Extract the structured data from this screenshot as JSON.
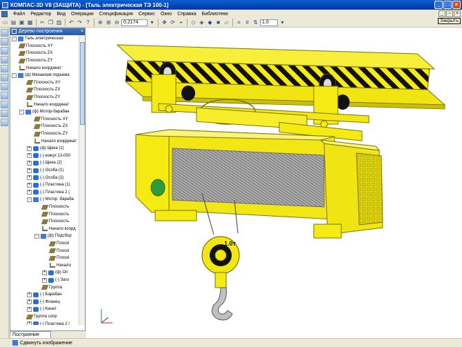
{
  "window": {
    "title": "КОМПАС-3D V8 (ЗАЩИТА) - [Таль электрическая   ТЭ 100-1]",
    "tooltip": "Закрыть"
  },
  "menu": {
    "items": [
      "Файл",
      "Редактор",
      "Вид",
      "Операции",
      "Спецификация",
      "Сервис",
      "Окно",
      "Справка",
      "Библиотеки"
    ]
  },
  "toolbar": {
    "zoom_value": "0.2174",
    "step_value": "1.0"
  },
  "tree": {
    "title": "Дерево построения",
    "tab_label": "Построение",
    "rows": [
      {
        "text": "Таль электрическая",
        "indent": 0,
        "icon": "asm",
        "exp": "-"
      },
      {
        "text": "Плоскость XY",
        "indent": 1,
        "icon": "plane",
        "exp": ""
      },
      {
        "text": "Плоскость ZX",
        "indent": 1,
        "icon": "plane",
        "exp": ""
      },
      {
        "text": "Плоскость ZY",
        "indent": 1,
        "icon": "plane",
        "exp": ""
      },
      {
        "text": "Начало координат",
        "indent": 1,
        "icon": "axis",
        "exp": ""
      },
      {
        "text": "(ф) Механизм подъема",
        "indent": 0,
        "icon": "asm",
        "exp": "-"
      },
      {
        "text": "Плоскость XY",
        "indent": 2,
        "icon": "plane",
        "exp": ""
      },
      {
        "text": "Плоскость ZX",
        "indent": 2,
        "icon": "plane",
        "exp": ""
      },
      {
        "text": "Плоскость ZY",
        "indent": 2,
        "icon": "plane",
        "exp": ""
      },
      {
        "text": "Начало координат",
        "indent": 2,
        "icon": "axis",
        "exp": ""
      },
      {
        "text": "(ф) Мотор-барабан",
        "indent": 1,
        "icon": "asm",
        "exp": "-"
      },
      {
        "text": "Плоскость XY",
        "indent": 3,
        "icon": "plane",
        "exp": ""
      },
      {
        "text": "Плоскость ZX",
        "indent": 3,
        "icon": "plane",
        "exp": ""
      },
      {
        "text": "Плоскость ZY",
        "indent": 3,
        "icon": "plane",
        "exp": ""
      },
      {
        "text": "Начало координат",
        "indent": 3,
        "icon": "axis",
        "exp": ""
      },
      {
        "text": "(ф) Щека (1)",
        "indent": 2,
        "icon": "part",
        "exp": "+"
      },
      {
        "text": "(-) кожух 13-050",
        "indent": 2,
        "icon": "part",
        "exp": "+"
      },
      {
        "text": "(-) Щека (2)",
        "indent": 2,
        "icon": "part",
        "exp": "+"
      },
      {
        "text": "(-) Ocoба (1)",
        "indent": 2,
        "icon": "part",
        "exp": "+"
      },
      {
        "text": "(-) Ocoба (2)",
        "indent": 2,
        "icon": "part",
        "exp": "+"
      },
      {
        "text": "(-) Пластина (1)",
        "indent": 2,
        "icon": "part",
        "exp": "+"
      },
      {
        "text": "(-) Пластина 2 (",
        "indent": 2,
        "icon": "part",
        "exp": "+"
      },
      {
        "text": "(-) Мотор -бараба",
        "indent": 2,
        "icon": "asm",
        "exp": "-"
      },
      {
        "text": "Плоскость",
        "indent": 4,
        "icon": "plane",
        "exp": ""
      },
      {
        "text": "Плоскость",
        "indent": 4,
        "icon": "plane",
        "exp": ""
      },
      {
        "text": "Плоскость",
        "indent": 4,
        "icon": "plane",
        "exp": ""
      },
      {
        "text": "Начало коорд",
        "indent": 4,
        "icon": "axis",
        "exp": ""
      },
      {
        "text": "(ф) Подсбор",
        "indent": 3,
        "icon": "asm",
        "exp": "-"
      },
      {
        "text": "Плоскі",
        "indent": 5,
        "icon": "plane",
        "exp": ""
      },
      {
        "text": "Плоскі",
        "indent": 5,
        "icon": "plane",
        "exp": ""
      },
      {
        "text": "Плоскі",
        "indent": 5,
        "icon": "plane",
        "exp": ""
      },
      {
        "text": "Начало",
        "indent": 5,
        "icon": "axis",
        "exp": ""
      },
      {
        "text": "(ф) Оп",
        "indent": 4,
        "icon": "part",
        "exp": "+"
      },
      {
        "text": "(-) Заго",
        "indent": 4,
        "icon": "part",
        "exp": "+"
      },
      {
        "text": "Группа",
        "indent": 4,
        "icon": "plane",
        "exp": ""
      },
      {
        "text": "(-) Барабан",
        "indent": 2,
        "icon": "part",
        "exp": "+"
      },
      {
        "text": "(-) Фланец",
        "indent": 2,
        "icon": "part",
        "exp": "+"
      },
      {
        "text": "(-) Канат",
        "indent": 2,
        "icon": "part",
        "exp": "+"
      },
      {
        "text": "Группа сопр",
        "indent": 2,
        "icon": "plane",
        "exp": ""
      },
      {
        "text": "(-) Пластина 2 (",
        "indent": 2,
        "icon": "part",
        "exp": "+"
      }
    ]
  },
  "model": {
    "hook_label": "1.0т"
  },
  "status": {
    "text": "Сдвинуть изображение"
  },
  "colors": {
    "titlebar": "#0a4fc8",
    "model_yellow": "#f5ea12",
    "model_outline": "#7a7400"
  }
}
